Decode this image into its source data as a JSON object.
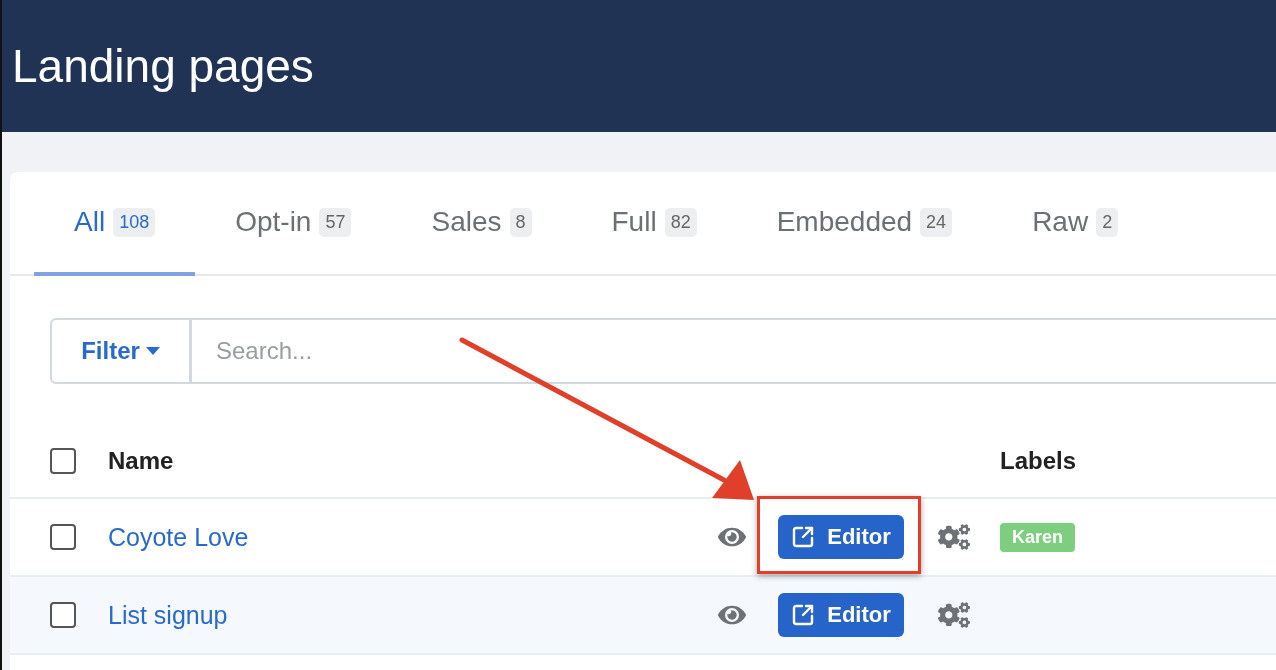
{
  "header": {
    "title": "Landing pages"
  },
  "tabs": [
    {
      "label": "All",
      "count": "108",
      "selected": true
    },
    {
      "label": "Opt-in",
      "count": "57",
      "selected": false
    },
    {
      "label": "Sales",
      "count": "8",
      "selected": false
    },
    {
      "label": "Full",
      "count": "82",
      "selected": false
    },
    {
      "label": "Embedded",
      "count": "24",
      "selected": false
    },
    {
      "label": "Raw",
      "count": "2",
      "selected": false
    }
  ],
  "filter": {
    "label": "Filter",
    "placeholder": "Search..."
  },
  "table": {
    "columns": [
      "Name",
      "Labels"
    ],
    "header_checked": false,
    "rows": [
      {
        "name": "Coyote Love",
        "checked": false,
        "action": "Editor",
        "highlighted": true,
        "labels": [
          {
            "text": "Karen",
            "color": "#7dcf7f"
          }
        ]
      },
      {
        "name": "List signup",
        "checked": false,
        "action": "Editor",
        "highlighted": false,
        "labels": []
      }
    ]
  }
}
